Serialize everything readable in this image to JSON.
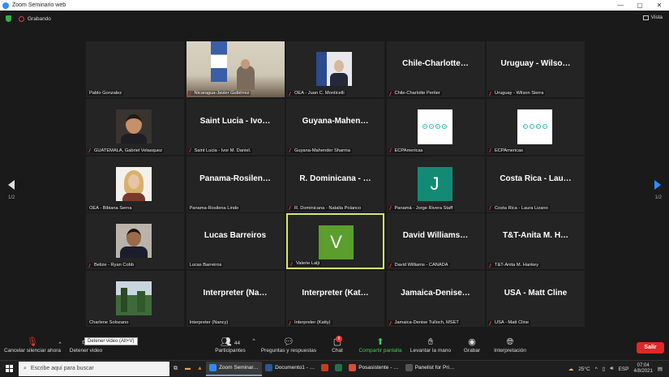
{
  "window": {
    "title": "Zoom Seminario web",
    "minimize": "—",
    "maximize": "▢",
    "close": "✕"
  },
  "recording": {
    "label": "Grabando"
  },
  "view": {
    "label": "Vista"
  },
  "pagination": {
    "left": "1/2",
    "right": "1/2"
  },
  "tiles": [
    {
      "label": "Pablo Gonzalez",
      "kind": "blank",
      "muted": false
    },
    {
      "label": "Nicaragua-Javier Gutiérrez",
      "kind": "video-flag",
      "muted": true
    },
    {
      "label": "OEA - Juan C. Monticelli",
      "kind": "photo-suit",
      "muted": true
    },
    {
      "label": "Chile-Charlotte Pertier",
      "kind": "name",
      "big": "Chile-Charlotte…",
      "muted": true
    },
    {
      "label": "Uruguay - Wilson Sierra",
      "kind": "name",
      "big": "Uruguay - Wilso…",
      "muted": true
    },
    {
      "label": "GUATEMALA, Gabriel Velasquez",
      "kind": "photo-man",
      "muted": true
    },
    {
      "label": "Saint Lucia - Ivor M. Daniel.",
      "kind": "name",
      "big": "Saint Lucia - Ivo…",
      "muted": true
    },
    {
      "label": "Guyana-Mahender Sharma",
      "kind": "name",
      "big": "Guyana-Mahen…",
      "muted": true
    },
    {
      "label": "ECPAmericas",
      "kind": "ecpa",
      "muted": true
    },
    {
      "label": "ECPAmericas",
      "kind": "ecpa",
      "muted": true
    },
    {
      "label": "OEA - Bibiana Serna",
      "kind": "photo-woman",
      "muted": false
    },
    {
      "label": "Panama-Rosilena Lindo",
      "kind": "name",
      "big": "Panama-Rosilen…",
      "muted": false
    },
    {
      "label": "R. Dominicana - Natalia Polanco",
      "kind": "name",
      "big": "R. Dominicana - …",
      "muted": true
    },
    {
      "label": "Panamá - Jorge Rivera Staff",
      "kind": "avatar",
      "letter": "J",
      "color": "#138b74",
      "muted": true
    },
    {
      "label": "Costa Rica - Laura Lizano",
      "kind": "name",
      "big": "Costa Rica - Lau…",
      "muted": true
    },
    {
      "label": "Belize - Ryan Cobb",
      "kind": "photo-man2",
      "muted": true
    },
    {
      "label": "Lucas Barreiros",
      "kind": "name",
      "big": "Lucas Barreiros",
      "muted": false
    },
    {
      "label": "Valerie Lalji",
      "kind": "avatar",
      "letter": "V",
      "color": "#5c9e2d",
      "muted": true,
      "active": true
    },
    {
      "label": "David Williams - CANADA",
      "kind": "name",
      "big": "David Williams…",
      "muted": true
    },
    {
      "label": "T&T-Anita M. Hankey",
      "kind": "name",
      "big": "T&T-Anita M. H…",
      "muted": true
    },
    {
      "label": "Charlene Solozano",
      "kind": "photo-landscape",
      "muted": false
    },
    {
      "label": "Interpreter (Nancy)",
      "kind": "name",
      "big": "Interpreter (Na…",
      "muted": false
    },
    {
      "label": "Interpreter (Katty)",
      "kind": "name",
      "big": "Interpreter (Kat…",
      "muted": true
    },
    {
      "label": "Jamaica-Denise Tulloch, MSET",
      "kind": "name",
      "big": "Jamaica-Denise…",
      "muted": true
    },
    {
      "label": "USA - Matt Cline",
      "kind": "name",
      "big": "USA - Matt Cline",
      "muted": true
    }
  ],
  "toolbar": {
    "mute": "Cancelar silenciar ahora",
    "video": "Detener video",
    "video_tooltip": "Detener video (Alt+V)",
    "participants": "Participantes",
    "participants_count": "44",
    "qa": "Preguntas y respuestas",
    "chat": "Chat",
    "chat_badge": "6",
    "share": "Compartir pantalla",
    "raise_hand": "Levantar la mano",
    "record": "Grabar",
    "interpretation": "Interpretación",
    "leave": "Salir"
  },
  "taskbar": {
    "search_placeholder": "Escribe aquí para buscar",
    "apps": [
      {
        "label": "Zoom Seminar…",
        "color": "#2d8cff",
        "active": true
      },
      {
        "label": "Documento1 - …",
        "color": "#2b579a",
        "active": false
      },
      {
        "label": "",
        "color": "#c43e1c",
        "active": false
      },
      {
        "label": "",
        "color": "#217346",
        "active": false
      },
      {
        "label": "Posasistente - …",
        "color": "#dd4b39",
        "active": false
      },
      {
        "label": "Panelist for Pri…",
        "color": "#555555",
        "active": false
      }
    ],
    "temperature": "25°C",
    "language": "ESP",
    "time": "07:04",
    "date": "4/8/2021"
  }
}
